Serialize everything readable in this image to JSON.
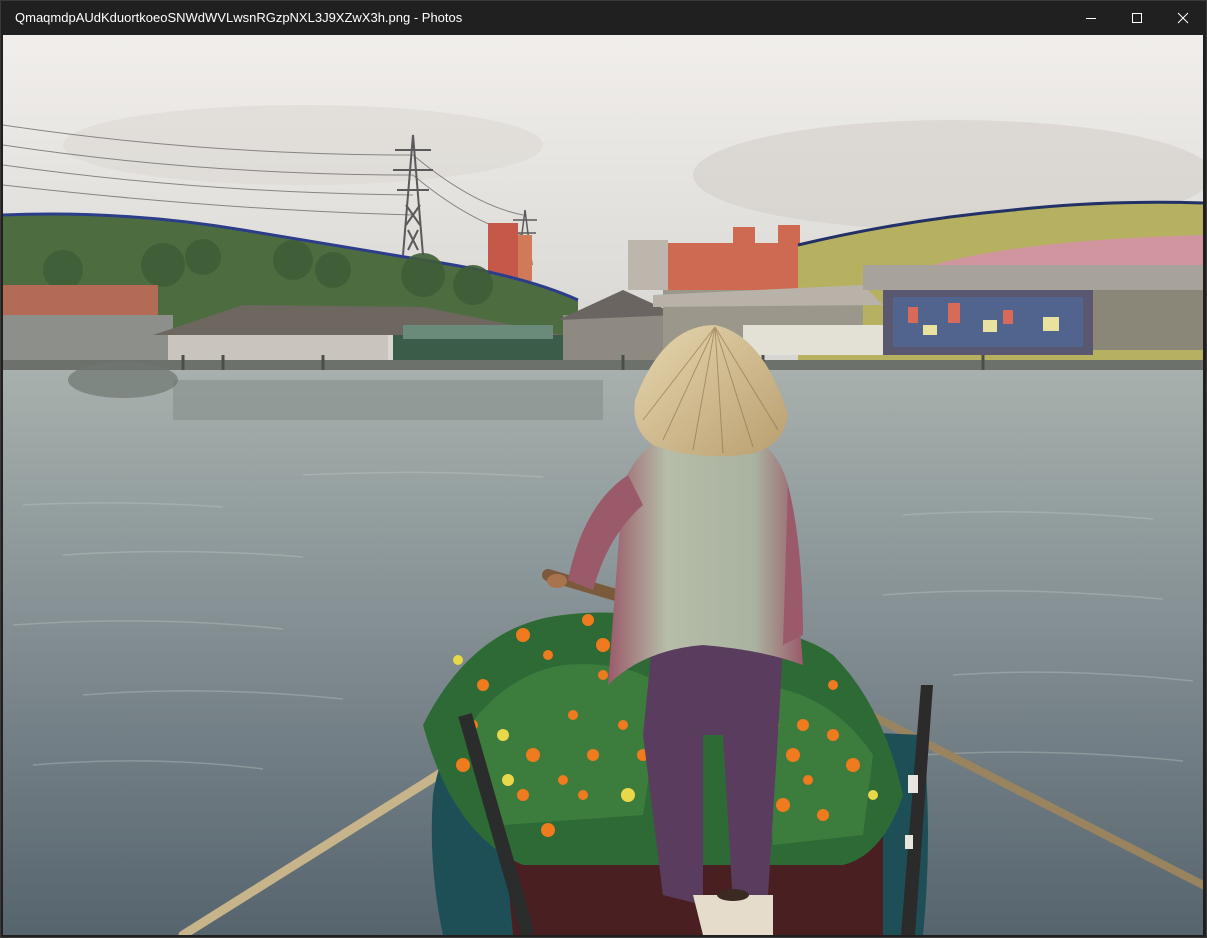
{
  "window": {
    "title": "QmaqmdpAUdKduortkoeoSNWdWVLwsnRGzpNXL3J9XZwX3h.png - Photos",
    "controls": {
      "minimize_icon": "minimize-icon",
      "maximize_icon": "maximize-icon",
      "close_icon": "close-icon"
    }
  },
  "photo": {
    "colors": {
      "sky_top": "#ece9e6",
      "sky_bottom": "#d8d6d2",
      "water_top": "#9ea8a5",
      "water_bottom": "#5d6b74",
      "hillside": "#4a6a3c",
      "boat": "#1f4f56",
      "marigold": "#f07a1e",
      "leaves": "#2e6a35",
      "hat": "#d8c49a",
      "jacket": "#a8b4a2",
      "jacket_shadow": "#9a5a6a",
      "trousers": "#5a3d5e",
      "oar": "#c7b48a"
    }
  }
}
